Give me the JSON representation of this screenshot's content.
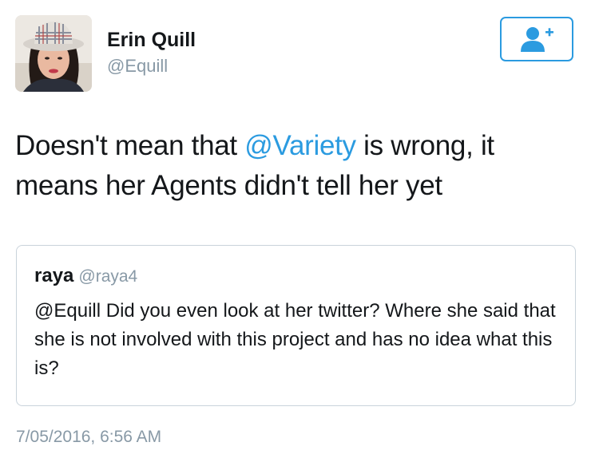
{
  "author": {
    "display_name": "Erin Quill",
    "handle": "@Equill"
  },
  "follow_button": {
    "icon": "follow-user-plus-icon",
    "accent_color": "#2b9be0"
  },
  "tweet": {
    "text_before": "Doesn't mean that ",
    "mention": "@Variety",
    "text_after": " is wrong, it means her Agents didn't tell her yet"
  },
  "quoted_tweet": {
    "author_name": "raya",
    "author_handle": "@raya4",
    "text": "@Equill  Did you even look at her twitter? Where she said that she is not involved with this project and has no idea what this is?"
  },
  "timestamp": "7/05/2016, 6:56 AM",
  "colors": {
    "link": "#2b9be0",
    "secondary_text": "#8899a6",
    "primary_text": "#14171a",
    "card_border": "#c9d3db"
  }
}
